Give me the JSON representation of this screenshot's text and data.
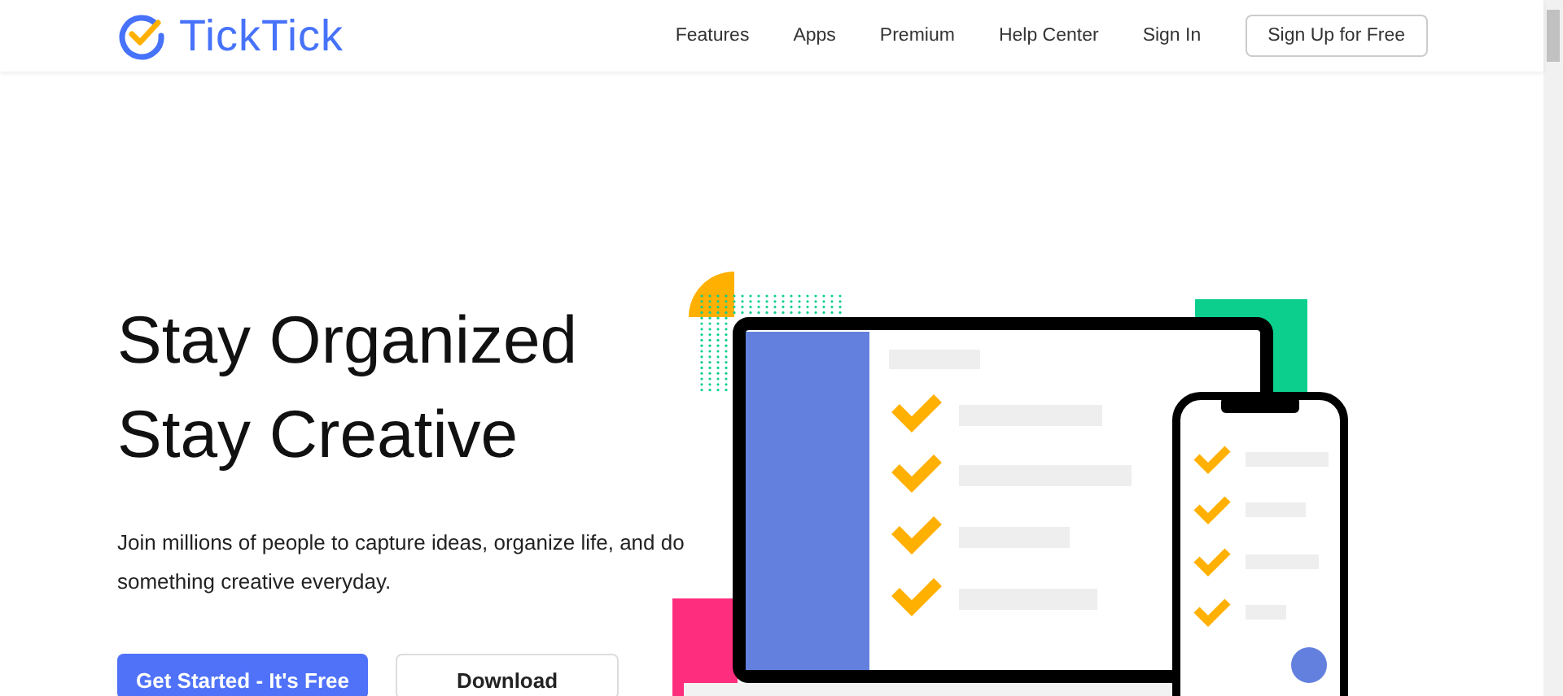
{
  "header": {
    "logo": "TickTick",
    "nav": [
      {
        "label": "Features"
      },
      {
        "label": "Apps"
      },
      {
        "label": "Premium"
      },
      {
        "label": "Help Center"
      },
      {
        "label": "Sign In"
      }
    ],
    "signup_button": "Sign Up for Free"
  },
  "hero": {
    "title_lines": [
      "Stay Organized",
      "Stay Creative"
    ],
    "description": "Join millions of people to capture ideas, organize life, and do something creative everyday.",
    "primary_button": "Get Started - It's Free",
    "secondary_button": "Download"
  }
}
